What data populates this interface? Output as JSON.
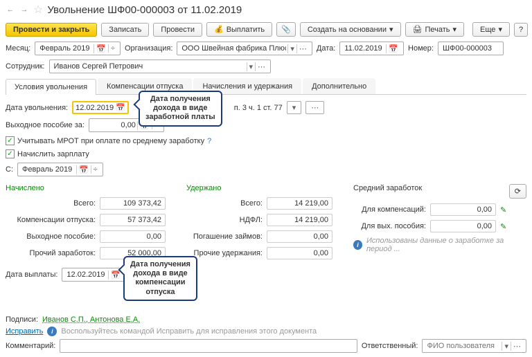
{
  "header": {
    "title": "Увольнение ШФ00-000003 от 11.02.2019"
  },
  "toolbar": {
    "post_close": "Провести и закрыть",
    "save": "Записать",
    "post": "Провести",
    "pay": "Выплатить",
    "create_based": "Создать на основании",
    "print": "Печать",
    "more": "Еще"
  },
  "form": {
    "month_label": "Месяц:",
    "month": "Февраль 2019",
    "org_label": "Организация:",
    "org": "ООО Швейная фабрика Плюс",
    "date_label": "Дата:",
    "date": "11.02.2019",
    "number_label": "Номер:",
    "number": "ШФ00-000003",
    "employee_label": "Сотрудник:",
    "employee": "Иванов Сергей Петрович"
  },
  "tabs": {
    "t1": "Условия увольнения",
    "t2": "Компенсации отпуска",
    "t3": "Начисления и удержания",
    "t4": "Дополнительно"
  },
  "conditions": {
    "dismiss_date_label": "Дата увольнения:",
    "dismiss_date": "12.02.2019",
    "reason_suffix": "п. 3 ч. 1 ст. 77",
    "severance_label": "Выходное пособие за:",
    "severance_val": "0,00",
    "mrot": "Учитывать МРОТ при оплате по среднему заработку",
    "calc_salary": "Начислить зарплату",
    "from_label": "С:",
    "from_month": "Февраль 2019"
  },
  "callout1": {
    "l1": "Дата получения",
    "l2": "дохода в виде",
    "l3": "заработной платы"
  },
  "callout2": {
    "l1": "Дата получения",
    "l2": "дохода в виде",
    "l3": "компенсации",
    "l4": "отпуска"
  },
  "columns": {
    "accrued": "Начислено",
    "withheld": "Удержано",
    "avg": "Средний заработок",
    "total": "Всего:",
    "total_acc": "109 373,42",
    "total_wh": "14 219,00",
    "comp_label": "Компенсации отпуска:",
    "comp_val": "57 373,42",
    "ndfl": "НДФЛ:",
    "ndfl_val": "14 219,00",
    "sev_label": "Выходное пособие:",
    "sev_val": "0,00",
    "loan": "Погашение займов:",
    "loan_val": "0,00",
    "other_label": "Прочий заработок:",
    "other_val": "52 000,00",
    "other_wh": "Прочие удержания:",
    "other_wh_val": "0,00",
    "for_comp": "Для компенсаций:",
    "for_comp_val": "0,00",
    "for_sev": "Для вых. пособия:",
    "for_sev_val": "0,00",
    "used_info": "Использованы данные о заработке за период ..."
  },
  "pay_date_label": "Дата выплаты:",
  "pay_date": "12.02.2019",
  "signatures_label": "Подписи:",
  "signatures": "Иванов С.П., Антонова Е.А.",
  "fix": "Исправить",
  "fix_hint": "Воспользуйтесь командой Исправить для исправления этого документа",
  "comment_label": "Комментарий:",
  "resp_label": "Ответственный:",
  "resp_placeholder": "ФИО пользователя"
}
